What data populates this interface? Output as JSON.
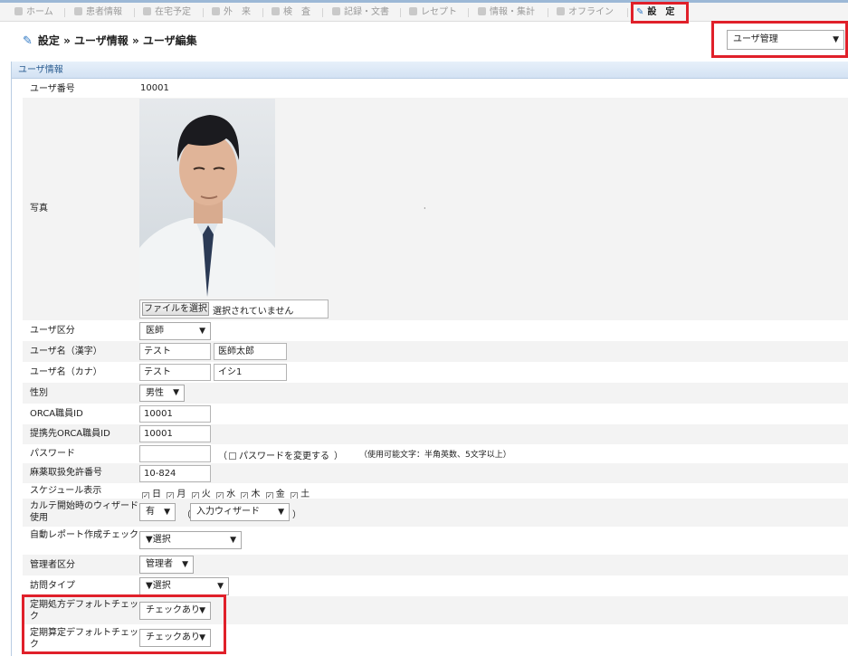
{
  "nav": [
    {
      "label": "ホーム",
      "icon": "home-icon"
    },
    {
      "label": "患者情報",
      "icon": "patient-icon"
    },
    {
      "label": "在宅予定",
      "icon": "clock-icon"
    },
    {
      "label": "外　来",
      "icon": "outpatient-icon"
    },
    {
      "label": "検　査",
      "icon": "exam-icon"
    },
    {
      "label": "記録・文書",
      "icon": "record-icon"
    },
    {
      "label": "レセプト",
      "icon": "receipt-icon"
    },
    {
      "label": "情報・集計",
      "icon": "stats-icon"
    },
    {
      "label": "オフライン",
      "icon": "offline-icon"
    },
    {
      "label": "設　定",
      "icon": "wrench-icon"
    }
  ],
  "breadcrumb": {
    "text": "設定 » ユーザ情報 » ユーザ編集"
  },
  "top_select": {
    "value": "ユーザ管理"
  },
  "panel": {
    "title": "ユーザ情報"
  },
  "labels": {
    "user_no": "ユーザ番号",
    "photo": "写真",
    "user_type": "ユーザ区分",
    "name_kanji": "ユーザ名（漢字）",
    "name_kana": "ユーザ名（カナ）",
    "gender": "性別",
    "orca_id": "ORCA職員ID",
    "partner_orca_id": "提携先ORCA職員ID",
    "password": "パスワード",
    "narcotic_no": "麻薬取扱免許番号",
    "schedule": "スケジュール表示",
    "wizard": "カルテ開始時のウィザード使用",
    "auto_report": "自動レポート作成チェック",
    "admin_type": "管理者区分",
    "visit_type": "訪問タイプ",
    "regular_rx": "定期処方デフォルトチェック",
    "regular_calc": "定期算定デフォルトチェック"
  },
  "values": {
    "user_no": "10001",
    "file_button": "ファイルを選択",
    "file_none": "選択されていません",
    "user_type": "医師",
    "name_kanji_1": "テスト",
    "name_kanji_2": "医師太郎",
    "name_kana_1": "テスト",
    "name_kana_2": "イシ1",
    "gender": "男性",
    "orca_id": "10001",
    "partner_orca_id": "10001",
    "pw_open": "（",
    "pw_change": "パスワードを変更する",
    "pw_close": "）",
    "pw_note": "（使用可能文字：半角英数、5文字以上）",
    "narcotic_no": "10-824",
    "days": [
      "日",
      "月",
      "火",
      "水",
      "木",
      "金",
      "土"
    ],
    "wizard_use": "有",
    "wizard_type": "入力ウィザード",
    "paren_open": "（",
    "paren_close": "）",
    "auto_report": "▼選択",
    "admin_type": "管理者",
    "visit_type": "▼選択",
    "regular_rx": "チェックあり",
    "regular_calc": "チェックあり"
  },
  "arrow": "▼",
  "check": "✓"
}
